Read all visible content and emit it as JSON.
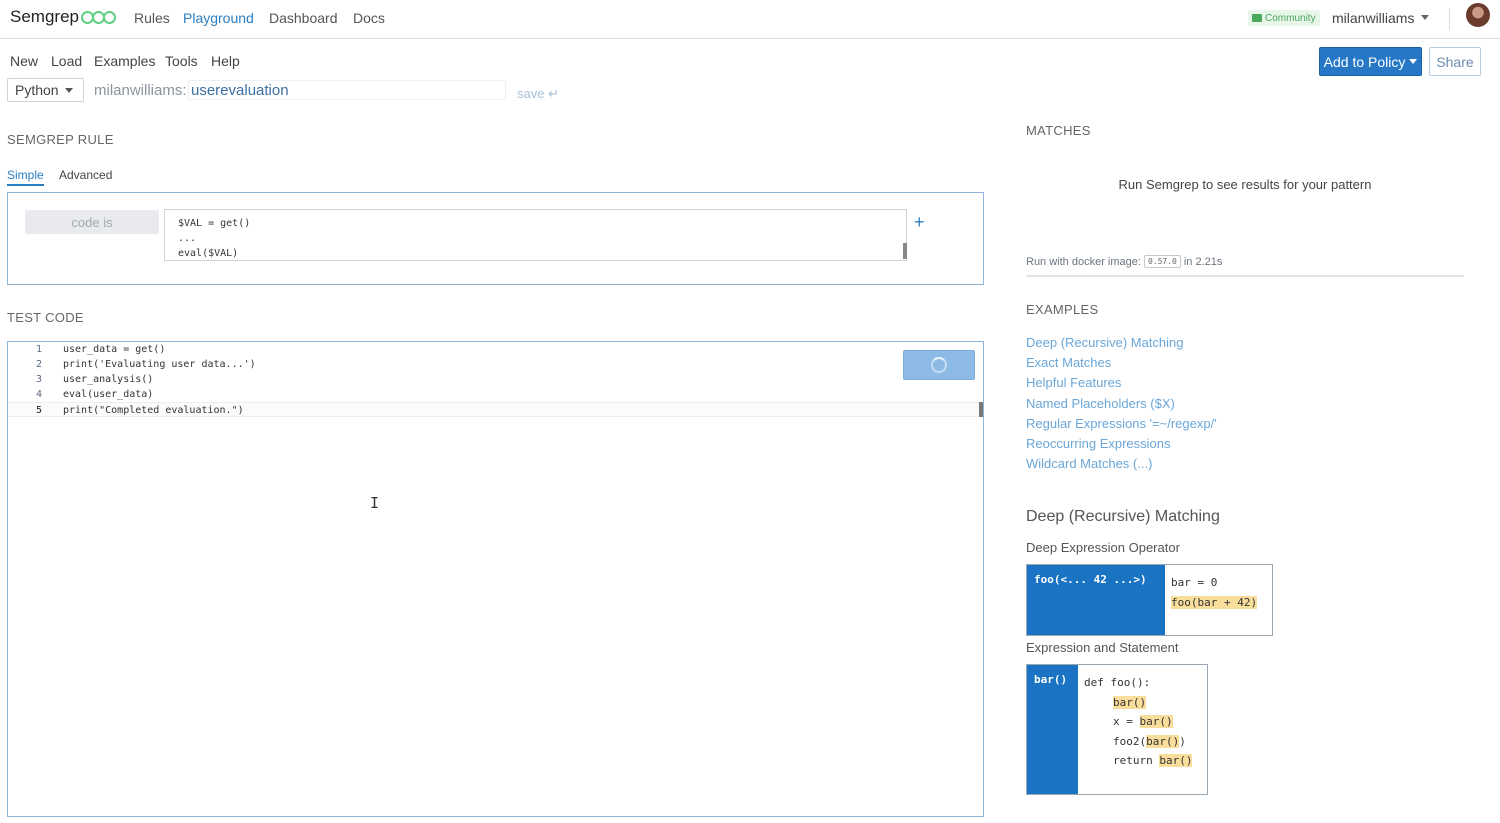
{
  "nav": {
    "brand": "Semgrep",
    "links": [
      "Rules",
      "Playground",
      "Dashboard",
      "Docs"
    ],
    "community_badge": "Community",
    "username": "milanwilliams"
  },
  "menu": {
    "items": [
      "New",
      "Load",
      "Examples",
      "Tools",
      "Help"
    ],
    "add_to_policy": "Add to Policy",
    "share": "Share"
  },
  "rule_meta": {
    "language": "Python",
    "owner": "milanwilliams:",
    "name": "userevaluation",
    "save": "save ↵"
  },
  "rule": {
    "section_title": "SEMGREP RULE",
    "tabs": [
      "Simple",
      "Advanced"
    ],
    "condition": "code is",
    "pattern_lines": [
      "$VAL = get()",
      "...",
      "eval($VAL)"
    ]
  },
  "test_code": {
    "section_title": "TEST CODE",
    "lines": [
      {
        "num": "1",
        "text": "user_data = get()"
      },
      {
        "num": "2",
        "text": "print('Evaluating user data...')"
      },
      {
        "num": "3",
        "text": "user_analysis()"
      },
      {
        "num": "4",
        "text": "eval(user_data)"
      },
      {
        "num": "5",
        "text": "print(\"Completed evaluation.\")"
      }
    ]
  },
  "matches": {
    "section_title": "MATCHES",
    "empty_message": "Run Semgrep to see results for your pattern",
    "docker_prefix": "Run with docker image:",
    "docker_version": "0.57.0",
    "docker_suffix": "in 2.21s"
  },
  "examples": {
    "section_title": "EXAMPLES",
    "links": [
      "Deep (Recursive) Matching",
      "Exact Matches",
      "Helpful Features",
      "Named Placeholders ($X)",
      "Regular Expressions '=~/regexp/'",
      "Reoccurring Expressions",
      "Wildcard Matches (...)"
    ]
  },
  "detail": {
    "title": "Deep (Recursive) Matching",
    "demo1": {
      "subtitle": "Deep Expression Operator",
      "pattern": "foo(<... 42 ...>)",
      "code_line1": "bar = 0",
      "code_line2": "foo(bar + 42)"
    },
    "demo2": {
      "subtitle": "Expression and Statement",
      "pattern": "bar()",
      "def": "def foo():",
      "hl": "bar()",
      "x_prefix": "x = ",
      "foo2_prefix": "foo2(",
      "foo2_suffix": ")",
      "return_prefix": "return "
    }
  }
}
